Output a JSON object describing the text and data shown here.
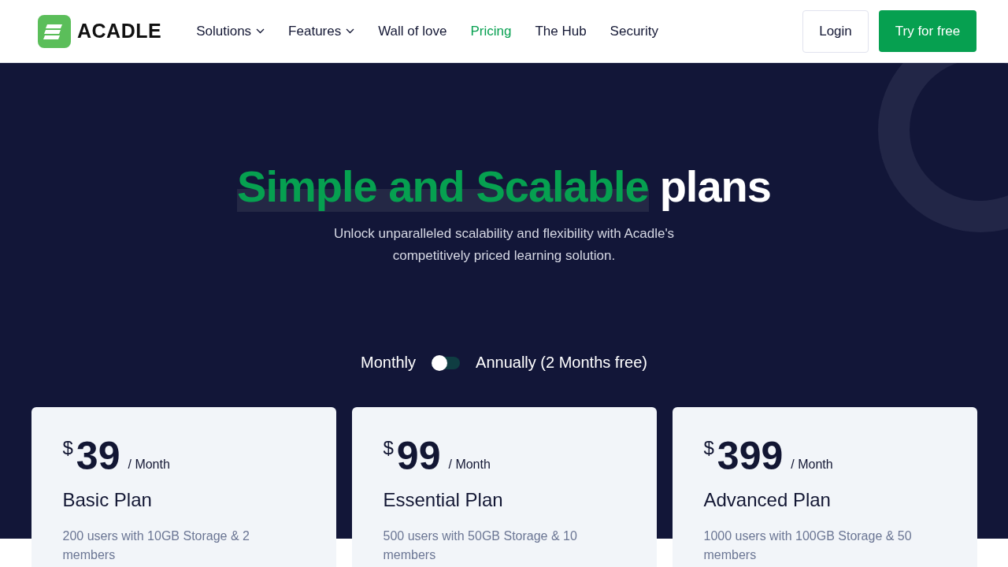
{
  "nav": {
    "logo": "ACADLE",
    "links": [
      {
        "label": "Solutions",
        "dropdown": true,
        "selected": false
      },
      {
        "label": "Features",
        "dropdown": true,
        "selected": false
      },
      {
        "label": "Wall of love",
        "dropdown": false,
        "selected": false
      },
      {
        "label": "Pricing",
        "dropdown": false,
        "selected": true
      },
      {
        "label": "The Hub",
        "dropdown": false,
        "selected": false
      },
      {
        "label": "Security",
        "dropdown": false,
        "selected": false
      }
    ],
    "login": "Login",
    "cta": "Try for free"
  },
  "hero": {
    "title_highlight": "Simple and Scalable",
    "title_rest": "plans",
    "subtitle": "Unlock unparalleled scalability and flexibility with Acadle's competitively priced learning solution."
  },
  "billing": {
    "monthly": "Monthly",
    "annually": "Annually (2 Months free)",
    "annual": false
  },
  "plans": [
    {
      "currency": "$",
      "price": "39",
      "period": "/ Month",
      "name": "Basic Plan",
      "description": "200 users with 10GB Storage & 2 members"
    },
    {
      "currency": "$",
      "price": "99",
      "period": "/ Month",
      "name": "Essential Plan",
      "description": "500 users with 50GB Storage & 10 members"
    },
    {
      "currency": "$",
      "price": "399",
      "period": "/ Month",
      "name": "Advanced Plan",
      "description": "1000 users with 100GB Storage & 50 members"
    }
  ]
}
